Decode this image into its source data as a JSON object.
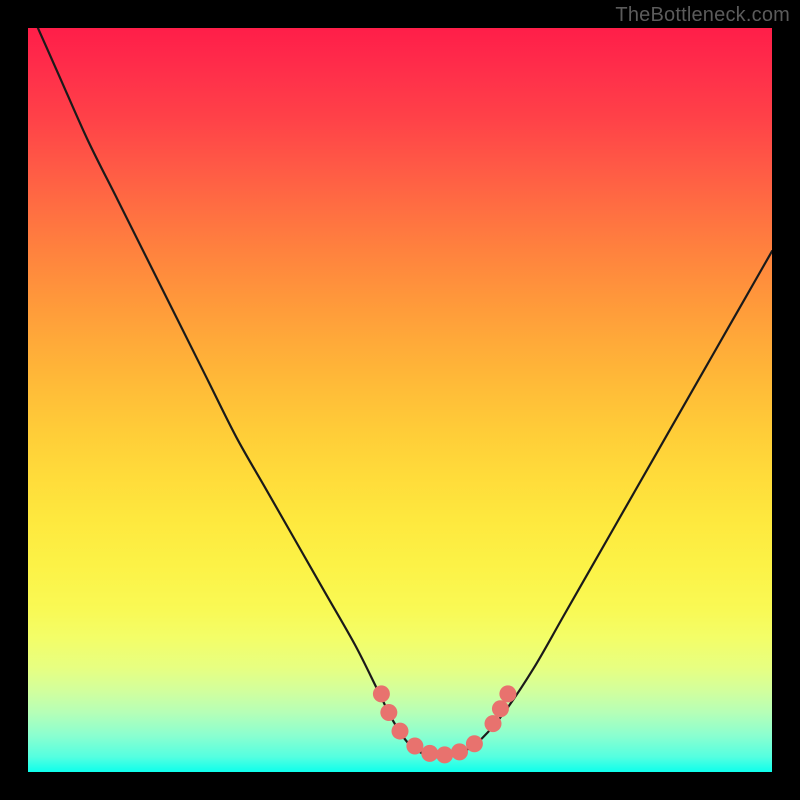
{
  "watermark": "TheBottleneck.com",
  "colors": {
    "curve_stroke": "#1a1a1a",
    "marker_fill": "#e8726e",
    "frame_bg": "#000000"
  },
  "chart_data": {
    "type": "line",
    "title": "",
    "xlabel": "",
    "ylabel": "",
    "xlim": [
      0,
      100
    ],
    "ylim": [
      0,
      100
    ],
    "x": [
      0,
      4,
      8,
      12,
      16,
      20,
      24,
      28,
      32,
      36,
      40,
      44,
      47,
      49,
      51,
      53,
      55,
      57,
      59,
      61,
      64,
      68,
      72,
      76,
      80,
      84,
      88,
      92,
      96,
      100
    ],
    "series": [
      {
        "name": "bottleneck-curve",
        "values": [
          103,
          94,
          85,
          77,
          69,
          61,
          53,
          45,
          38,
          31,
          24,
          17,
          11,
          7,
          4,
          2.5,
          2,
          2.2,
          3,
          4.5,
          8,
          14,
          21,
          28,
          35,
          42,
          49,
          56,
          63,
          70
        ]
      }
    ],
    "markers": [
      {
        "x": 47.5,
        "y": 10.5
      },
      {
        "x": 48.5,
        "y": 8.0
      },
      {
        "x": 50.0,
        "y": 5.5
      },
      {
        "x": 52.0,
        "y": 3.5
      },
      {
        "x": 54.0,
        "y": 2.5
      },
      {
        "x": 56.0,
        "y": 2.3
      },
      {
        "x": 58.0,
        "y": 2.7
      },
      {
        "x": 60.0,
        "y": 3.8
      },
      {
        "x": 62.5,
        "y": 6.5
      },
      {
        "x": 63.5,
        "y": 8.5
      },
      {
        "x": 64.5,
        "y": 10.5
      }
    ]
  }
}
